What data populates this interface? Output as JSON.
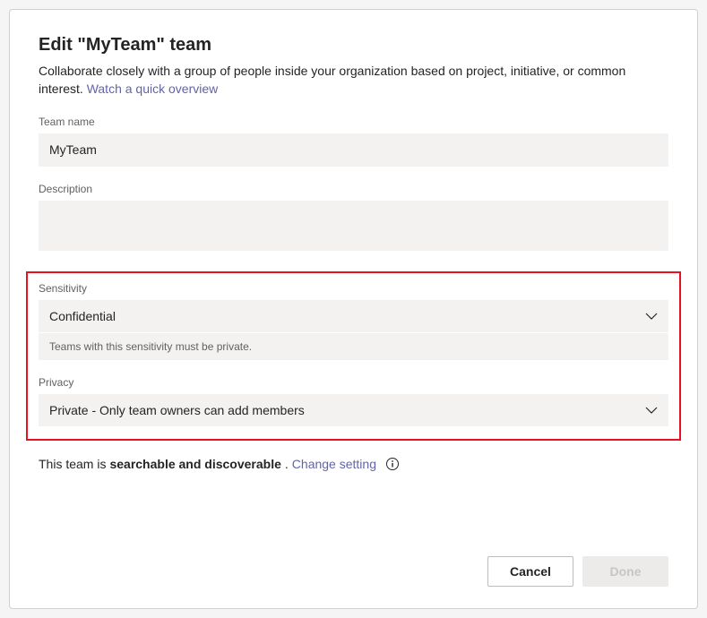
{
  "title": "Edit \"MyTeam\" team",
  "subtitle_prefix": "Collaborate closely with a group of people inside your organization based on project, initiative, or common interest. ",
  "subtitle_link": "Watch a quick overview",
  "fields": {
    "team_name": {
      "label": "Team name",
      "value": "MyTeam"
    },
    "description": {
      "label": "Description",
      "value": ""
    },
    "sensitivity": {
      "label": "Sensitivity",
      "value": "Confidential",
      "helper": "Teams with this sensitivity must be private."
    },
    "privacy": {
      "label": "Privacy",
      "value": "Private - Only team owners can add members"
    }
  },
  "discoverable": {
    "prefix": "This team is ",
    "bold": "searchable and discoverable",
    "suffix": ". ",
    "link": "Change setting"
  },
  "footer": {
    "cancel": "Cancel",
    "done": "Done"
  }
}
